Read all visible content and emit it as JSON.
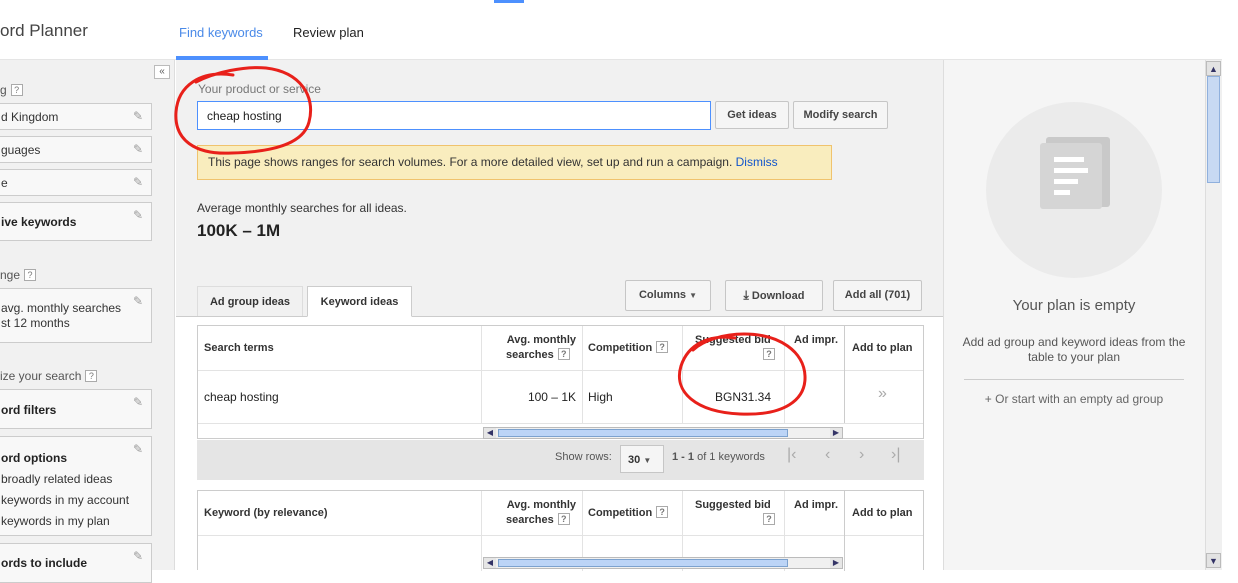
{
  "app": {
    "title": "ord Planner"
  },
  "top_tabs": [
    {
      "label": "Find keywords"
    },
    {
      "label": "Review plan"
    }
  ],
  "sidebar": {
    "collapse_icon": "«",
    "targeting_label": "g",
    "location": "d Kingdom",
    "languages": "guages",
    "network": "e",
    "negative_keywords": "ive keywords",
    "date_range_label": "nge",
    "date_range_line1": "avg. monthly searches",
    "date_range_line2": "st 12 months",
    "customize_label": "ize your search",
    "keyword_filters": "ord filters",
    "keyword_options": "ord options",
    "option1": "broadly related ideas",
    "option2": "keywords in my account",
    "option3": "keywords in my plan",
    "keywords_to_include": "ords to include"
  },
  "search": {
    "label": "Your product or service",
    "value": "cheap hosting",
    "get_ideas": "Get ideas",
    "modify": "Modify search"
  },
  "notice": {
    "text": "This page shows ranges for search volumes. For a more detailed view, set up and run a campaign. ",
    "dismiss": "Dismiss"
  },
  "avg": {
    "label": "Average monthly searches for all ideas.",
    "value": "100K – 1M"
  },
  "lower_tabs": [
    {
      "label": "Ad group ideas"
    },
    {
      "label": "Keyword ideas"
    }
  ],
  "toolbar": {
    "columns": "Columns",
    "download": "Download",
    "add_all": "Add all (701)"
  },
  "table1": {
    "headers": {
      "term": "Search terms",
      "avg1": "Avg. monthly",
      "avg2": "searches",
      "competition": "Competition",
      "bid1": "Suggested bid",
      "impr": "Ad impr.",
      "add": "Add to plan"
    },
    "row": {
      "term": "cheap hosting",
      "avg": "100 – 1K",
      "competition": "High",
      "bid": "BGN31.34",
      "add_icon": "»"
    }
  },
  "pager": {
    "show_rows": "Show rows:",
    "rows": "30",
    "range_bold": "1 - 1",
    "range_rest": " of 1 keywords"
  },
  "table2": {
    "headers": {
      "term": "Keyword (by relevance)",
      "avg1": "Avg. monthly",
      "avg2": "searches",
      "competition": "Competition",
      "bid1": "Suggested bid",
      "impr": "Ad impr.",
      "add": "Add to plan"
    }
  },
  "right_panel": {
    "empty_title": "Your plan is empty",
    "help": "Add ad group and keyword ideas from the table to your plan",
    "start": "+ Or start with an empty ad group"
  },
  "colors": {
    "accent": "#4d90fe",
    "link": "#1155cc",
    "notice_bg": "#f9edbe",
    "annotation": "#e8201a"
  }
}
